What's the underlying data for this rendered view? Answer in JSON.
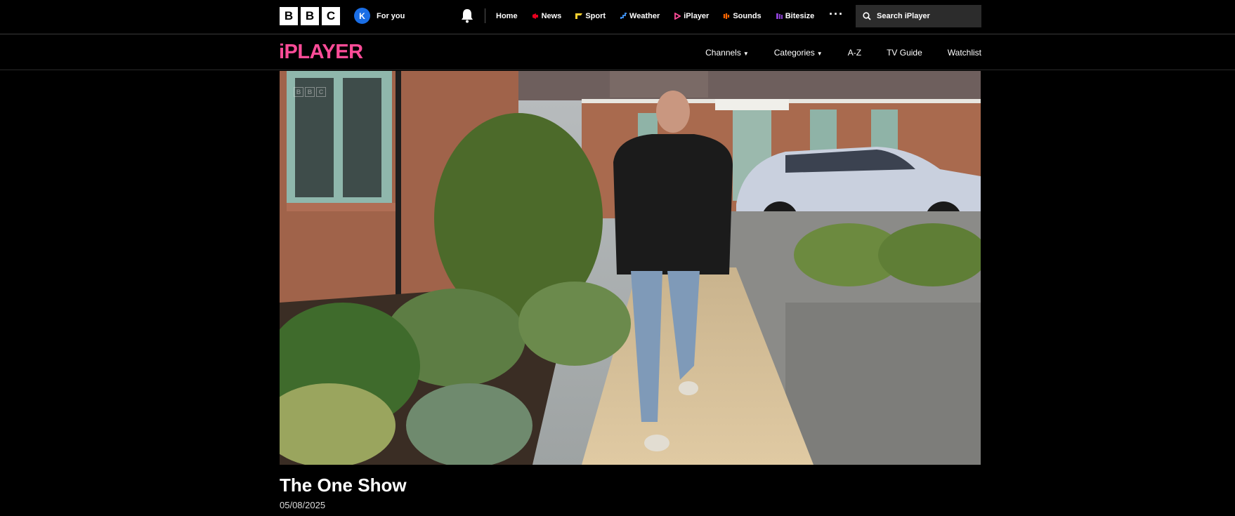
{
  "header": {
    "brand_letters": [
      "B",
      "B",
      "C"
    ],
    "account_initial": "K",
    "for_you_label": "For you",
    "nav": [
      {
        "label": "Home",
        "icon": null,
        "color": null
      },
      {
        "label": "News",
        "icon": "news-icon",
        "color": "#e6001e"
      },
      {
        "label": "Sport",
        "icon": "sport-icon",
        "color": "#ffd230"
      },
      {
        "label": "Weather",
        "icon": "weather-icon",
        "color": "#3c8be8"
      },
      {
        "label": "iPlayer",
        "icon": "iplayer-icon",
        "color": "#ff4c98"
      },
      {
        "label": "Sounds",
        "icon": "sounds-icon",
        "color": "#ff6600"
      },
      {
        "label": "Bitesize",
        "icon": "bitesize-icon",
        "color": "#8a3fd1"
      }
    ],
    "more_label": "···",
    "search_placeholder": "Search iPlayer"
  },
  "iplayer": {
    "logo": "iPLAYER",
    "logo_color": "#ff4c98",
    "nav": [
      {
        "label": "Channels",
        "dropdown": true
      },
      {
        "label": "Categories",
        "dropdown": true
      },
      {
        "label": "A-Z",
        "dropdown": false
      },
      {
        "label": "TV Guide",
        "dropdown": false
      },
      {
        "label": "Watchlist",
        "dropdown": false
      }
    ]
  },
  "video": {
    "watermark": [
      "B",
      "B",
      "C"
    ]
  },
  "programme": {
    "title": "The One Show",
    "date": "05/08/2025"
  }
}
